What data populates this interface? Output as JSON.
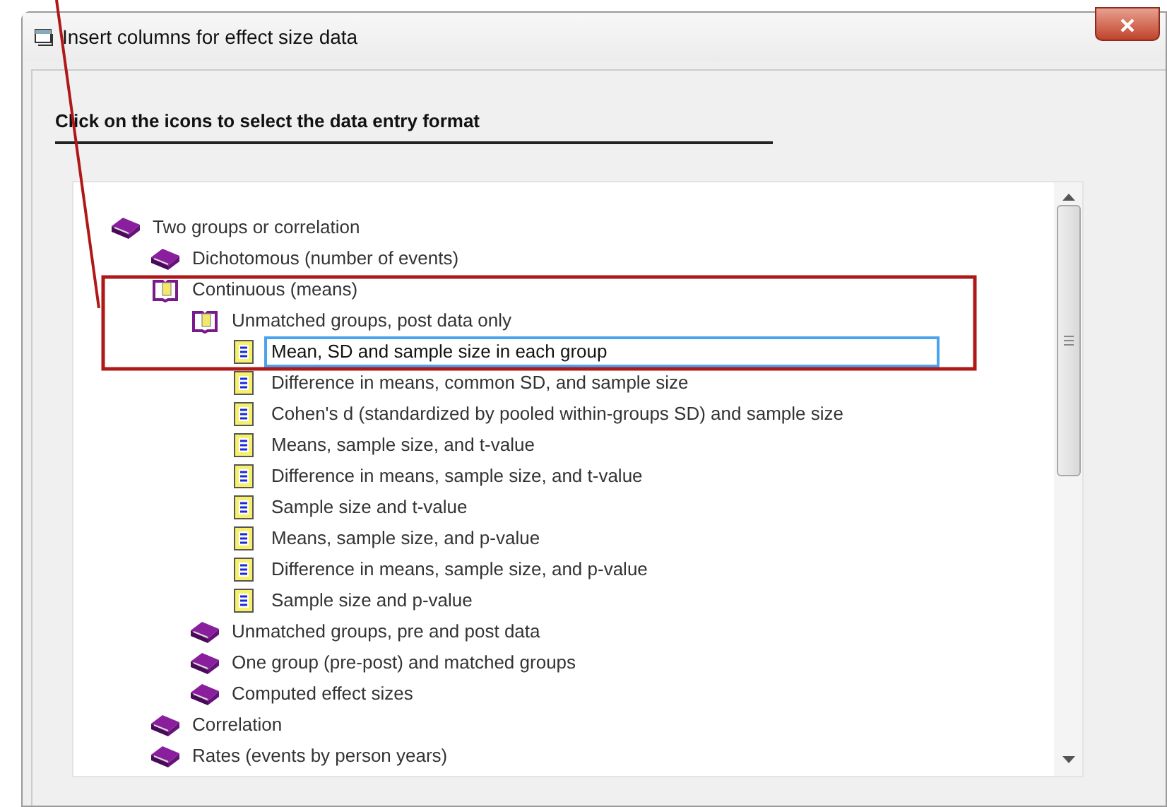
{
  "window": {
    "title": "Insert columns for effect size data"
  },
  "instruction": "Click on the icons to select the data entry format",
  "tree": [
    {
      "label": "Two groups or correlation",
      "kind": "book",
      "expanded": true,
      "selected": false,
      "children": [
        {
          "label": "Dichotomous (number of events)",
          "kind": "book",
          "selected": false
        },
        {
          "label": "Continuous (means)",
          "kind": "open-book",
          "expanded": true,
          "selected": false,
          "children": [
            {
              "label": "Unmatched groups, post data only",
              "kind": "open-book",
              "expanded": true,
              "selected": false,
              "children": [
                {
                  "label": "Mean, SD and sample size in each group",
                  "kind": "format",
                  "selected": true
                },
                {
                  "label": "Difference in means, common SD, and sample size",
                  "kind": "format",
                  "selected": false
                },
                {
                  "label": "Cohen's d (standardized by pooled within-groups SD) and sample size",
                  "kind": "format",
                  "selected": false
                },
                {
                  "label": "Means, sample size, and t-value",
                  "kind": "format",
                  "selected": false
                },
                {
                  "label": "Difference in means, sample size, and t-value",
                  "kind": "format",
                  "selected": false
                },
                {
                  "label": "Sample size and t-value",
                  "kind": "format",
                  "selected": false
                },
                {
                  "label": "Means, sample size, and p-value",
                  "kind": "format",
                  "selected": false
                },
                {
                  "label": "Difference in means, sample size, and p-value",
                  "kind": "format",
                  "selected": false
                },
                {
                  "label": "Sample size and p-value",
                  "kind": "format",
                  "selected": false
                }
              ]
            },
            {
              "label": "Unmatched groups, pre and post data",
              "kind": "book",
              "selected": false
            },
            {
              "label": "One group (pre-post) and matched groups",
              "kind": "book",
              "selected": false
            },
            {
              "label": "Computed effect sizes",
              "kind": "book",
              "selected": false
            }
          ]
        },
        {
          "label": "Correlation",
          "kind": "book",
          "selected": false
        },
        {
          "label": "Rates (events by person years)",
          "kind": "book",
          "selected": false
        }
      ]
    }
  ]
}
